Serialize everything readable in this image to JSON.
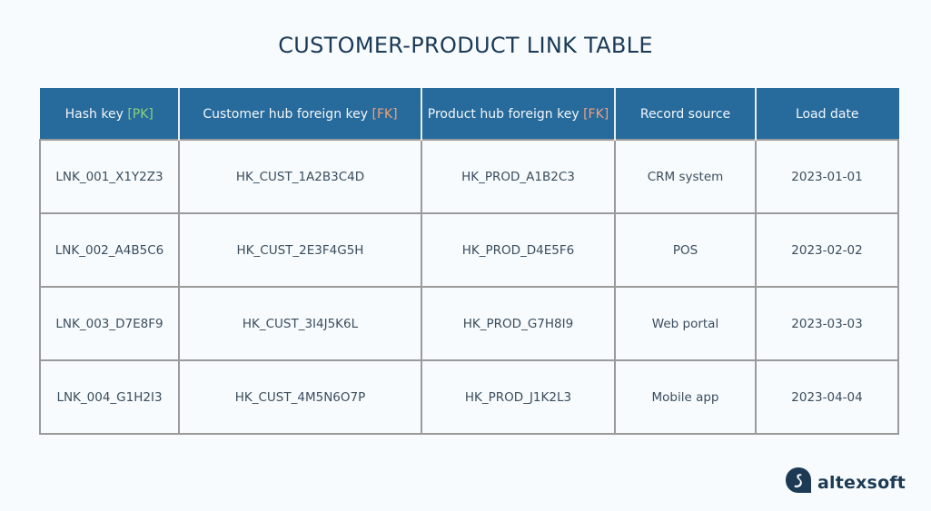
{
  "title": "CUSTOMER-PRODUCT LINK TABLE",
  "table": {
    "headers": [
      {
        "label": "Hash key",
        "tag": "[PK]",
        "tag_type": "pk"
      },
      {
        "label": "Customer hub foreign key",
        "tag": "[FK]",
        "tag_type": "fk"
      },
      {
        "label": "Product hub foreign key",
        "tag": "[FK]",
        "tag_type": "fk"
      },
      {
        "label": "Record source",
        "tag": "",
        "tag_type": ""
      },
      {
        "label": "Load date",
        "tag": "",
        "tag_type": ""
      }
    ],
    "rows": [
      [
        "LNK_001_X1Y2Z3",
        "HK_CUST_1A2B3C4D",
        "HK_PROD_A1B2C3",
        "CRM system",
        "2023-01-01"
      ],
      [
        "LNK_002_A4B5C6",
        "HK_CUST_2E3F4G5H",
        "HK_PROD_D4E5F6",
        "POS",
        "2023-02-02"
      ],
      [
        "LNK_003_D7E8F9",
        "HK_CUST_3I4J5K6L",
        "HK_PROD_G7H8I9",
        "Web portal",
        "2023-03-03"
      ],
      [
        "LNK_004_G1H2I3",
        "HK_CUST_4M5N6O7P",
        "HK_PROD_J1K2L3",
        "Mobile app",
        "2023-04-04"
      ]
    ]
  },
  "colors": {
    "header_bg": "#276a9c",
    "title": "#1b3a57",
    "pk_tag": "#8dd27e",
    "fk_tag": "#f0a07c",
    "border": "#9a9a9a",
    "logo": "#1d3a54"
  },
  "logo": {
    "icon": "altexsoft-logo-icon",
    "text": "altexsoft"
  }
}
